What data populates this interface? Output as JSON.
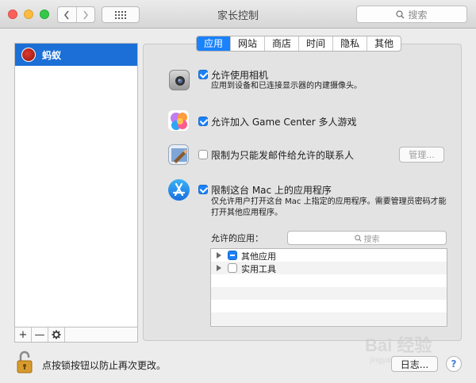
{
  "window": {
    "title": "家长控制",
    "search_placeholder": "搜索"
  },
  "sidebar": {
    "users": [
      {
        "name": "蚂蚁",
        "selected": true
      }
    ],
    "tools": {
      "add": "+",
      "remove": "—",
      "settings": "✲"
    }
  },
  "tabs": [
    {
      "label": "应用",
      "active": true
    },
    {
      "label": "网站",
      "active": false
    },
    {
      "label": "商店",
      "active": false
    },
    {
      "label": "时间",
      "active": false
    },
    {
      "label": "隐私",
      "active": false
    },
    {
      "label": "其他",
      "active": false
    }
  ],
  "settings": {
    "camera": {
      "label": "允许使用相机",
      "description": "应用到设备和已连接显示器的内建摄像头。",
      "checked": true
    },
    "game_center": {
      "label": "允许加入 Game Center 多人游戏",
      "checked": true
    },
    "mail": {
      "label": "限制为只能发邮件给允许的联系人",
      "checked": false,
      "manage_button": "管理..."
    },
    "limit_apps": {
      "label": "限制这台 Mac 上的应用程序",
      "description_line1": "仅允许用户打开这台 Mac 上指定的应用程序。需要管理员密码才能",
      "description_line2": "打开其他应用程序。",
      "checked": true
    }
  },
  "allowed_apps": {
    "label": "允许的应用：",
    "search_placeholder": "搜索",
    "items": [
      {
        "label": "其他应用",
        "state": "mixed"
      },
      {
        "label": "实用工具",
        "state": "unchecked"
      }
    ]
  },
  "footer": {
    "lock_text": "点按锁按钮以防止再次更改。",
    "log_button": "日志...",
    "help": "?"
  },
  "watermark": {
    "text": "Bai 经验",
    "subtext": "jingyan.baidu.com"
  },
  "colors": {
    "accent": "#1a82fb",
    "selection": "#1b6fd6"
  }
}
